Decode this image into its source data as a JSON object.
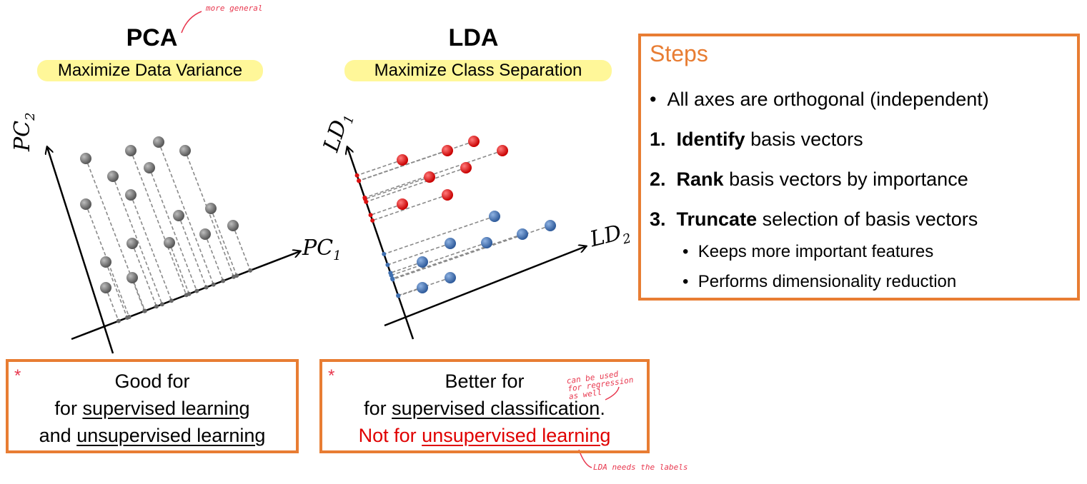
{
  "pca": {
    "title": "PCA",
    "subtitle": "Maximize Data Variance",
    "note": "more general",
    "axis_x": "PC",
    "axis_x_sub": "1",
    "axis_y": "PC",
    "axis_y_sub": "2",
    "box_line1": "Good for",
    "box_line2_pre": "for ",
    "box_line2_link": "supervised learning",
    "box_line3_pre": "and ",
    "box_line3_link": "unsupervised learning",
    "asterisk": "*"
  },
  "lda": {
    "title": "LDA",
    "subtitle": "Maximize Class Separation",
    "axis_x": "LD",
    "axis_x_sub": "2",
    "axis_y": "LD",
    "axis_y_sub": "1",
    "box_line1": "Better for",
    "box_line2_pre": "for ",
    "box_line2_link": "supervised classification",
    "box_line2_post": ".",
    "box_line3_pre": "Not for ",
    "box_line3_link": "unsupervised learning",
    "asterisk": "*",
    "note_regression": "can be used\nfor regression\nas well",
    "note_labels": "LDA needs the labels"
  },
  "steps": {
    "title": "Steps",
    "bullet": "All axes are orthogonal (independent)",
    "items": [
      {
        "num": "1.",
        "bold": "Identify",
        "rest": " basis vectors"
      },
      {
        "num": "2.",
        "bold": "Rank",
        "rest": " basis vectors by importance"
      },
      {
        "num": "3.",
        "bold": "Truncate",
        "rest": " selection of basis vectors"
      }
    ],
    "subitems": [
      "Keeps more important features",
      "Performs dimensionality reduction"
    ]
  },
  "colors": {
    "accent": "#e87d33",
    "highlight": "#fff799",
    "annotation": "#e8384f",
    "pca_point": "#777777",
    "lda_class1": "#dd1111",
    "lda_class2": "#3f6fb0"
  }
}
